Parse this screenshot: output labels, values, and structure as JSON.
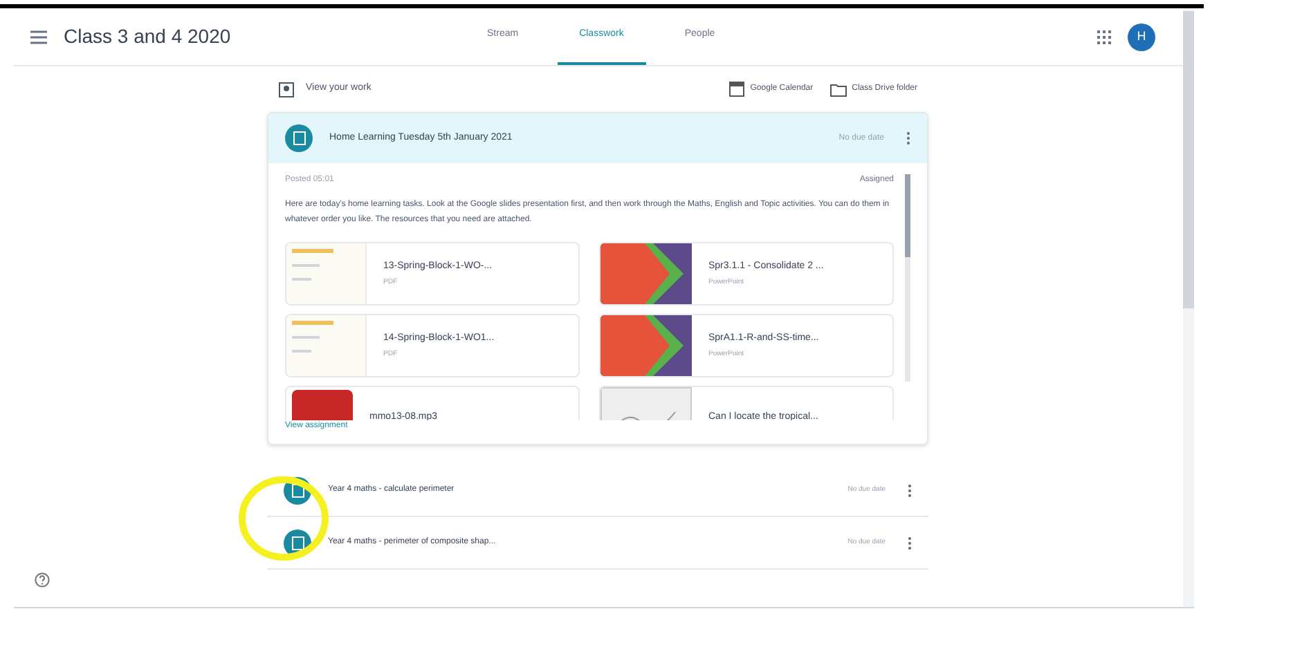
{
  "header": {
    "class_name": "Class 3 and 4 2020",
    "avatar_letter": "H",
    "tabs": [
      {
        "label": "Stream",
        "selected": false
      },
      {
        "label": "Classwork",
        "selected": true
      },
      {
        "label": "People",
        "selected": false
      }
    ]
  },
  "toolbar": {
    "view_work": "View your work",
    "links": [
      "Google Calendar",
      "Class Drive folder"
    ]
  },
  "open_assignment": {
    "title": "Home Learning Tuesday 5th January 2021",
    "due": "No due date",
    "posted": "Posted 05:01",
    "status": "Assigned",
    "description": "Here are today's home learning tasks. Look at the Google slides presentation first, and then work through the Maths, English and Topic activities. You can do them in whatever order you like. The resources that you need are attached.",
    "attachments": [
      {
        "name": "13-Spring-Block-1-WO-...",
        "type": "PDF",
        "kind": "doc"
      },
      {
        "name": "Spr3.1.1 - Consolidate 2 ...",
        "type": "PowerPoint",
        "kind": "slides"
      },
      {
        "name": "14-Spring-Block-1-WO1...",
        "type": "PDF",
        "kind": "doc"
      },
      {
        "name": "SprA1.1-R-and-SS-time...",
        "type": "PowerPoint",
        "kind": "slides"
      },
      {
        "name": "mmo13-08.mp3",
        "kind": "audio"
      },
      {
        "name": "Can I locate the tropical...",
        "kind": "sketch"
      }
    ],
    "view_link": "View assignment"
  },
  "assignments": [
    {
      "title": "Year 4 maths - calculate perimeter",
      "due": "No due date"
    },
    {
      "title": "Year 4 maths - perimeter of composite shap...",
      "due": "No due date"
    }
  ]
}
